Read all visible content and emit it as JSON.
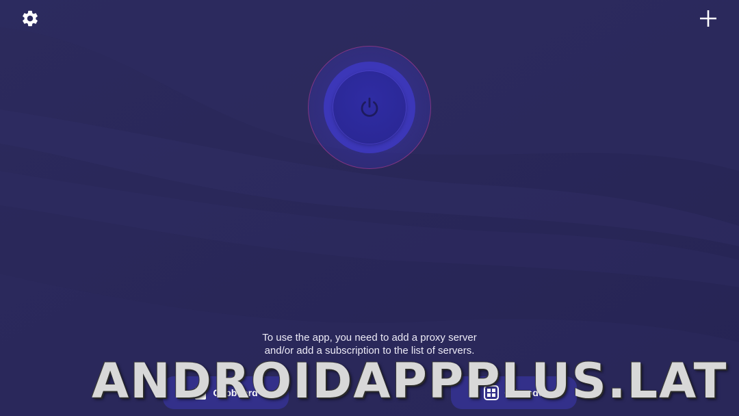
{
  "colors": {
    "background": "#2a2859",
    "power_ring": "#3c37b8",
    "power_button": "#2b2897",
    "button_bg": "#33308a",
    "text": "#eceaf6"
  },
  "header": {
    "settings_icon": "gear-icon",
    "add_icon": "plus-icon"
  },
  "power": {
    "icon": "power-icon"
  },
  "main": {
    "empty_message": "To use the app, you need to add a proxy server and/or add a subscription to the list of servers."
  },
  "bottom_actions": {
    "clipboard_label": "Clipboard",
    "clipboard_icon": "clipboard-icon",
    "qr_label": "QR code",
    "qr_icon": "qr-code-icon"
  },
  "watermark": {
    "text": "ANDROIDAPPPLUS.LAT"
  }
}
